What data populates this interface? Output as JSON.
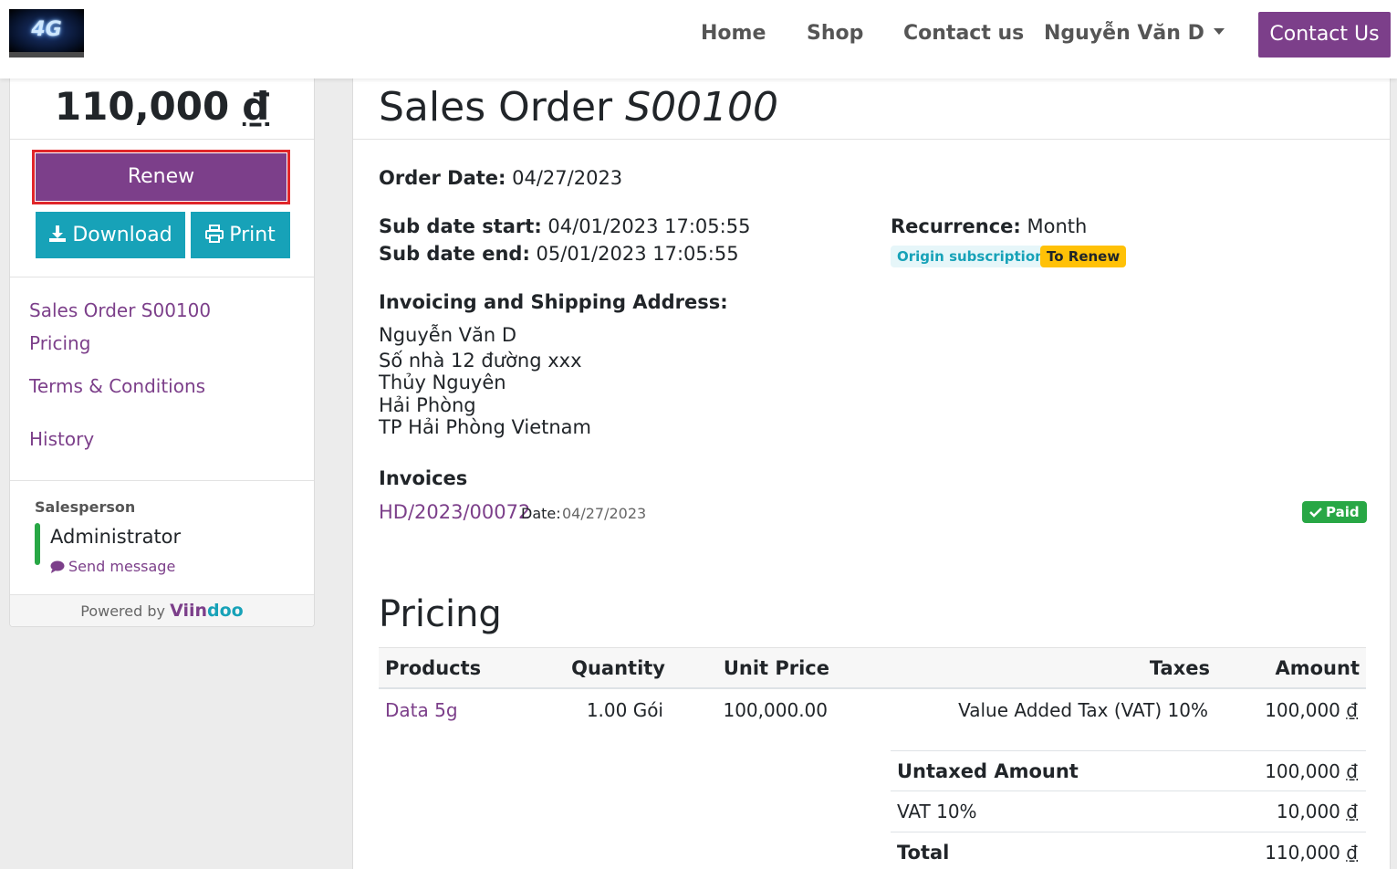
{
  "nav": {
    "logo_text": "4G",
    "home": "Home",
    "shop": "Shop",
    "contact": "Contact us",
    "user": "Nguyễn Văn D",
    "contact_button": "Contact Us"
  },
  "sidebar": {
    "amount": "110,000",
    "currency": "₫",
    "renew_label": "Renew",
    "download_label": "Download",
    "print_label": "Print",
    "links": [
      "Sales Order S00100",
      "Pricing",
      "Terms & Conditions",
      "History"
    ],
    "salesperson_label": "Salesperson",
    "salesperson_name": "Administrator",
    "send_message": "Send message",
    "powered_by": "Powered by",
    "brand_a": "Viin",
    "brand_b": "doo"
  },
  "order": {
    "title_prefix": "Sales Order",
    "number": "S00100",
    "order_date_label": "Order Date:",
    "order_date": "04/27/2023",
    "sub_start_label": "Sub date start:",
    "sub_start": "04/01/2023 17:05:55",
    "sub_end_label": "Sub date end:",
    "sub_end": "05/01/2023 17:05:55",
    "recurrence_label": "Recurrence:",
    "recurrence": "Month",
    "badge_origin": "Origin subscription",
    "badge_renew": "To Renew",
    "address_label": "Invoicing and Shipping Address:",
    "address_lines": [
      "Nguyễn Văn D",
      "Số nhà 12 đường xxx",
      "Thủy Nguyên",
      "Hải Phòng",
      "TP Hải Phòng Vietnam"
    ],
    "invoices_label": "Invoices",
    "invoice_number": "HD/2023/00072",
    "invoice_date_label": "Date:",
    "invoice_date": "04/27/2023",
    "invoice_status": "Paid"
  },
  "pricing": {
    "heading": "Pricing",
    "columns": [
      "Products",
      "Quantity",
      "Unit Price",
      "Taxes",
      "Amount"
    ],
    "rows": [
      {
        "product": "Data 5g",
        "quantity": "1.00 Gói",
        "unit_price": "100,000.00",
        "taxes": "Value Added Tax (VAT) 10%",
        "amount": "100,000"
      }
    ],
    "untaxed_label": "Untaxed Amount",
    "untaxed_value": "100,000",
    "vat_label": "VAT 10%",
    "vat_value": "10,000",
    "total_label": "Total",
    "total_value": "110,000",
    "currency": "₫"
  },
  "colors": {
    "brand_purple": "#7c3f8a",
    "info_teal": "#17a2b8",
    "warning_yellow": "#ffc107",
    "success_green": "#28a745",
    "highlight_red": "#e0262a"
  }
}
